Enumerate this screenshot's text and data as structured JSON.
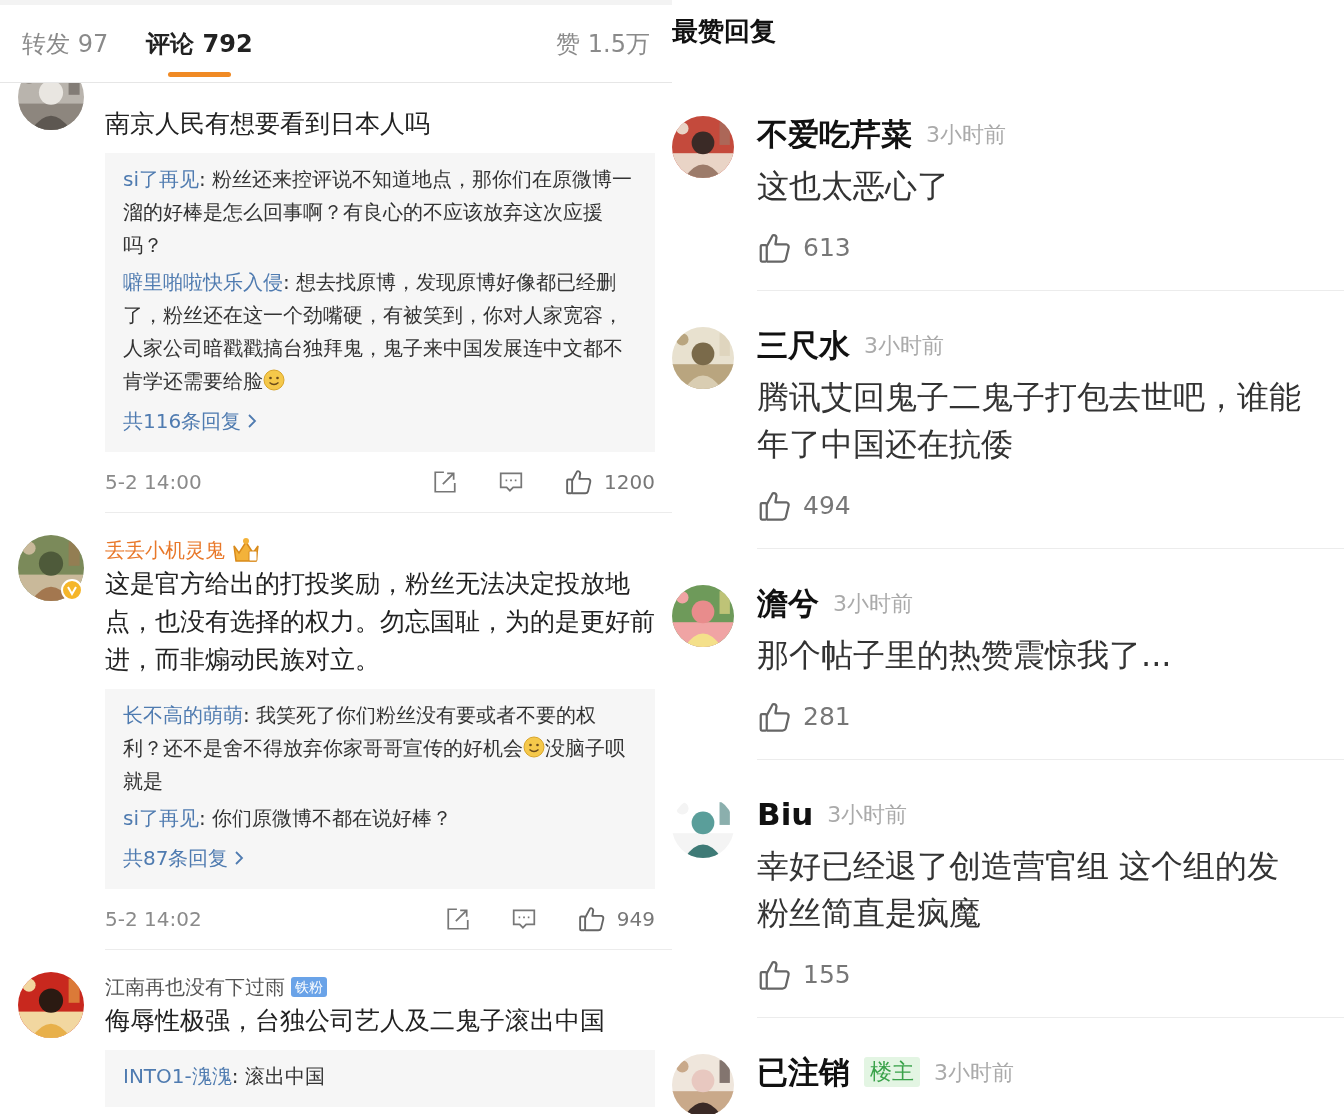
{
  "tabs": [
    {
      "label": "转发",
      "count": "97",
      "selected": false
    },
    {
      "label": "评论",
      "count": "792",
      "selected": true
    },
    {
      "label": "赞",
      "count": "1.5万",
      "selected": false
    }
  ],
  "comments": [
    {
      "text": "南京人民有想要看到日本人吗",
      "replies": [
        {
          "user": "si了再见",
          "content": [
            {
              "kind": "text",
              "text": ": 粉丝还来控评说不知道地点，那你们在原微博一溜的好棒是怎么回事啊？有良心的不应该放弃这次应援吗？"
            }
          ]
        },
        {
          "user": "噼里啪啦快乐入侵",
          "content": [
            {
              "kind": "text",
              "text": ": 想去找原博，发现原博好像都已经删了，粉丝还在这一个劲嘴硬，有被笑到，你对人家宽容，人家公司暗戳戳搞台独拜鬼，鬼子来中国发展连中文都不肯学还需要给脸"
            },
            {
              "kind": "emoji"
            }
          ]
        }
      ],
      "more": "共116条回复",
      "time": "5-2 14:00",
      "likes": "1200"
    },
    {
      "user": "丢丢小机灵鬼",
      "vip": true,
      "verified": true,
      "text": "这是官方给出的打投奖励，粉丝无法决定投放地点，也没有选择的权力。勿忘国耻，为的是更好前进，而非煽动民族对立。",
      "replies": [
        {
          "user": "长不高的萌萌",
          "content": [
            {
              "kind": "text",
              "text": ": 我笑死了你们粉丝没有要或者不要的权利？还不是舍不得放弃你家哥哥宣传的好机会"
            },
            {
              "kind": "emoji"
            },
            {
              "kind": "text",
              "text": "没脑子呗就是"
            }
          ]
        },
        {
          "user": "si了再见",
          "content": [
            {
              "kind": "text",
              "text": ": 你们原微博不都在说好棒？"
            }
          ]
        }
      ],
      "more": "共87条回复",
      "time": "5-2 14:02",
      "likes": "949"
    },
    {
      "user": "江南再也没有下过雨",
      "vip": false,
      "verified": false,
      "badge": "铁粉",
      "text": "侮辱性极强，台独公司艺人及二鬼子滚出中国",
      "replies": [
        {
          "user": "INTO1-溾溾",
          "content": [
            {
              "kind": "text",
              "text": ": 滚出中国"
            }
          ]
        }
      ]
    }
  ],
  "top_replies": {
    "title": "最赞回复",
    "items": [
      {
        "user": "不爱吃芹菜",
        "time": "3小时前",
        "lines": [
          "这也太恶心了"
        ],
        "likes": "613"
      },
      {
        "user": "三尺水",
        "time": "3小时前",
        "lines": [
          "腾讯艾回鬼子二鬼子打包去世吧，谁能",
          "年了中国还在抗倭"
        ],
        "likes": "494"
      },
      {
        "user": "澹兮",
        "time": "3小时前",
        "lines": [
          "那个帖子里的热赞震惊我了..."
        ],
        "likes": "281"
      },
      {
        "user": "Biu",
        "time": "3小时前",
        "lines": [
          "幸好已经退了创造营官组 这个组的发",
          "粉丝简直是疯魔"
        ],
        "likes": "155"
      },
      {
        "user": "已注销",
        "tag": "楼主",
        "time": "3小时前"
      }
    ]
  }
}
